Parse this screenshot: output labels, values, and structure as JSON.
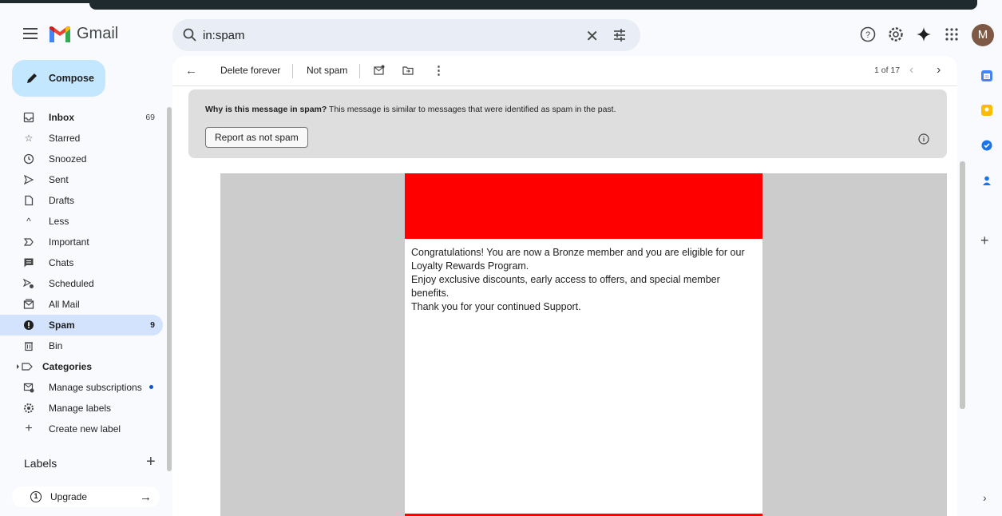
{
  "app": {
    "name": "Gmail",
    "avatar_letter": "M"
  },
  "search": {
    "value": "in:spam",
    "clear_glyph": "✕"
  },
  "header_icons": [
    "help-icon",
    "settings-icon",
    "gemini-icon",
    "apps-icon"
  ],
  "sidebar": {
    "compose_label": "Compose",
    "items": [
      {
        "label": "Inbox",
        "count": "69",
        "icon": "inbox-icon",
        "bold": true
      },
      {
        "label": "Starred",
        "count": "",
        "icon": "star-icon"
      },
      {
        "label": "Snoozed",
        "count": "",
        "icon": "clock-icon"
      },
      {
        "label": "Sent",
        "count": "",
        "icon": "send-icon"
      },
      {
        "label": "Drafts",
        "count": "",
        "icon": "draft-icon"
      },
      {
        "label": "Less",
        "count": "",
        "icon": "chevron-up-icon"
      },
      {
        "label": "Important",
        "count": "",
        "icon": "important-icon"
      },
      {
        "label": "Chats",
        "count": "",
        "icon": "chat-icon"
      },
      {
        "label": "Scheduled",
        "count": "",
        "icon": "scheduled-icon"
      },
      {
        "label": "All Mail",
        "count": "",
        "icon": "all-mail-icon"
      },
      {
        "label": "Spam",
        "count": "9",
        "icon": "spam-icon",
        "bold": true,
        "active": true
      },
      {
        "label": "Bin",
        "count": "",
        "icon": "bin-icon"
      },
      {
        "label": "Categories",
        "count": "",
        "icon": "label-icon",
        "bold": true
      },
      {
        "label": "Manage subscriptions",
        "count": "",
        "icon": "subscriptions-icon"
      },
      {
        "label": "Manage labels",
        "count": "",
        "icon": "gear-icon"
      },
      {
        "label": "Create new label",
        "count": "",
        "icon": "plus-icon"
      }
    ],
    "labels_header": "Labels",
    "upgrade_label": "Upgrade"
  },
  "toolbar": {
    "delete_label": "Delete forever",
    "not_spam_label": "Not spam",
    "pagination": "1 of 17"
  },
  "spam_banner": {
    "title": "Why is this message in spam?",
    "text": " This message is similar to messages that were identified as spam in the past.",
    "button_label": "Report as not spam"
  },
  "email": {
    "lines": [
      "Congratulations! You are now a Bronze member and you are eligible for our Loyalty Rewards Program.",
      "Enjoy exclusive discounts, early access to offers, and special member benefits.",
      "Thank you for your continued Support."
    ]
  },
  "colors": {
    "accent_compose": "#c2e7ff",
    "active_nav": "#d3e3fd",
    "email_red": "#ff0000",
    "banner": "#dedede",
    "email_side_gray": "#cccccc"
  }
}
